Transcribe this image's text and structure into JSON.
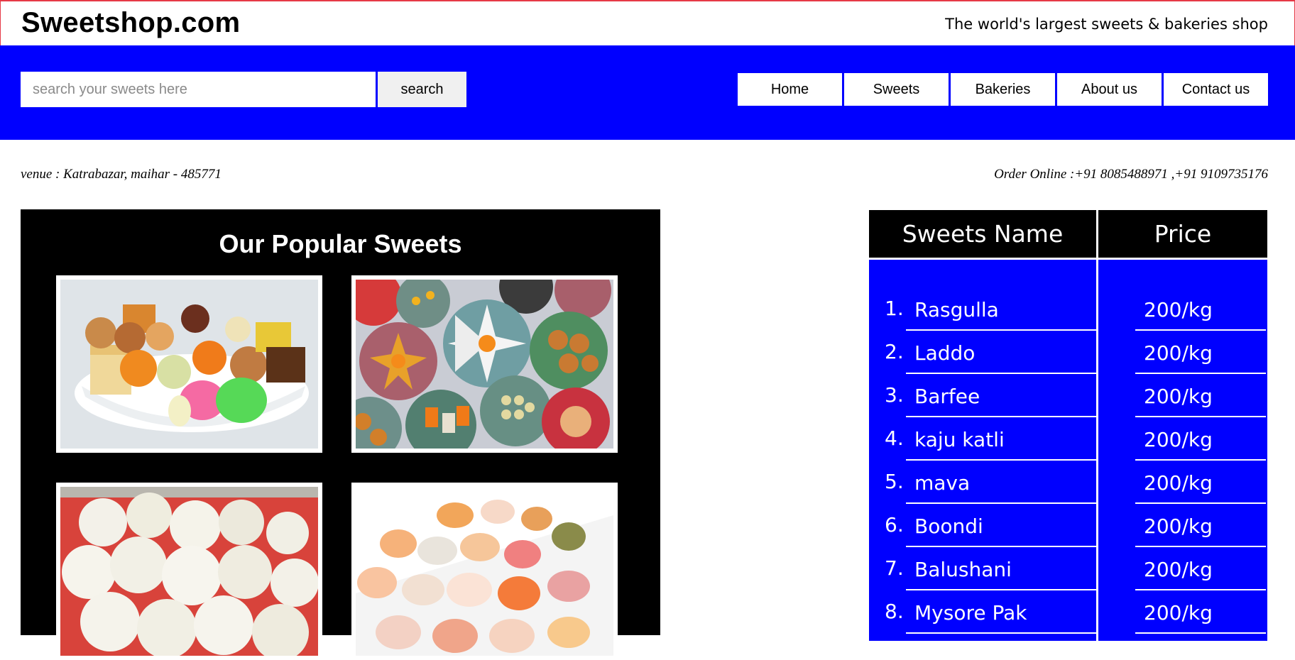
{
  "header": {
    "site_title": "Sweetshop.com",
    "tagline": "The world's largest sweets & bakeries shop"
  },
  "search": {
    "placeholder": "search your sweets here",
    "value": "",
    "button_label": "search"
  },
  "nav": {
    "items": [
      {
        "label": "Home"
      },
      {
        "label": "Sweets"
      },
      {
        "label": "Bakeries"
      },
      {
        "label": "About us"
      },
      {
        "label": "Contact us"
      }
    ]
  },
  "info": {
    "venue": "venue : Katrabazar, maihar - 485771",
    "order": "Order Online :+91 8085488971 ,+91 9109735176"
  },
  "popular": {
    "title": "Our Popular Sweets"
  },
  "price_table": {
    "header_name": "Sweets Name",
    "header_price": "Price",
    "rows": [
      {
        "num": "1.",
        "name": "Rasgulla",
        "price": "200/kg"
      },
      {
        "num": "2.",
        "name": "Laddo",
        "price": "200/kg"
      },
      {
        "num": "3.",
        "name": "Barfee",
        "price": "200/kg"
      },
      {
        "num": "4.",
        "name": "kaju katli",
        "price": "200/kg"
      },
      {
        "num": "5.",
        "name": "mava",
        "price": "200/kg"
      },
      {
        "num": "6.",
        "name": "Boondi",
        "price": "200/kg"
      },
      {
        "num": "7.",
        "name": "Balushani",
        "price": "200/kg"
      },
      {
        "num": "8.",
        "name": "Mysore Pak",
        "price": "200/kg"
      }
    ]
  },
  "colors": {
    "nav_bar": "#0000ff",
    "header_border": "#e63946",
    "table_body": "#0000ff",
    "popular_bg": "#000000"
  }
}
